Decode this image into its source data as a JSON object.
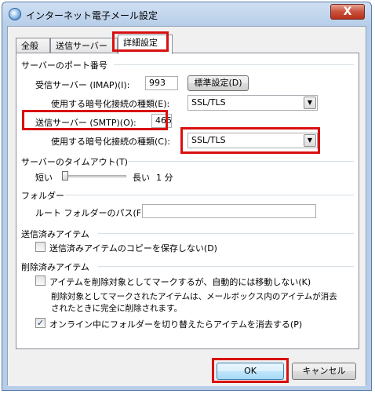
{
  "window": {
    "title": "インターネット電子メール設定",
    "close_label": "X"
  },
  "tabs": [
    "全般",
    "送信サーバー",
    "詳細設定"
  ],
  "server_ports": {
    "group_label": "サーバーのポート番号",
    "incoming_label": "受信サーバー (IMAP)(I):",
    "incoming_value": "993",
    "default_button": "標準設定(D)",
    "incoming_enc_label": "使用する暗号化接続の種類(E):",
    "incoming_enc_value": "SSL/TLS",
    "outgoing_label": "送信サーバー (SMTP)(O):",
    "outgoing_value": "465",
    "outgoing_enc_label": "使用する暗号化接続の種類(C):",
    "outgoing_enc_value": "SSL/TLS"
  },
  "timeout": {
    "group_label": "サーバーのタイムアウト(T)",
    "short_label": "短い",
    "long_label": "長い",
    "value_label": "1 分",
    "slider_fraction": 0.0
  },
  "folders": {
    "group_label": "フォルダー",
    "root_label": "ルート フォルダーのパス(F):",
    "root_value": ""
  },
  "sent": {
    "group_label": "送信済みアイテム",
    "no_copy_label": "送信済みアイテムのコピーを保存しない(D)",
    "no_copy_checked": false
  },
  "deleted": {
    "group_label": "削除済みアイテム",
    "mark_label": "アイテムを削除対象としてマークするが、自動的には移動しない(K)",
    "mark_checked": false,
    "note_line1": "削除対象としてマークされたアイテムは、メールボックス内のアイテムが消去",
    "note_line2": "されたときに完全に削除されます。",
    "purge_label": "オンライン中にフォルダーを切り替えたらアイテムを消去する(P)",
    "purge_checked": true
  },
  "footer": {
    "ok_label": "OK",
    "cancel_label": "キャンセル"
  },
  "colors": {
    "highlight": "#d81010",
    "titlebar": "#b7cde8"
  }
}
